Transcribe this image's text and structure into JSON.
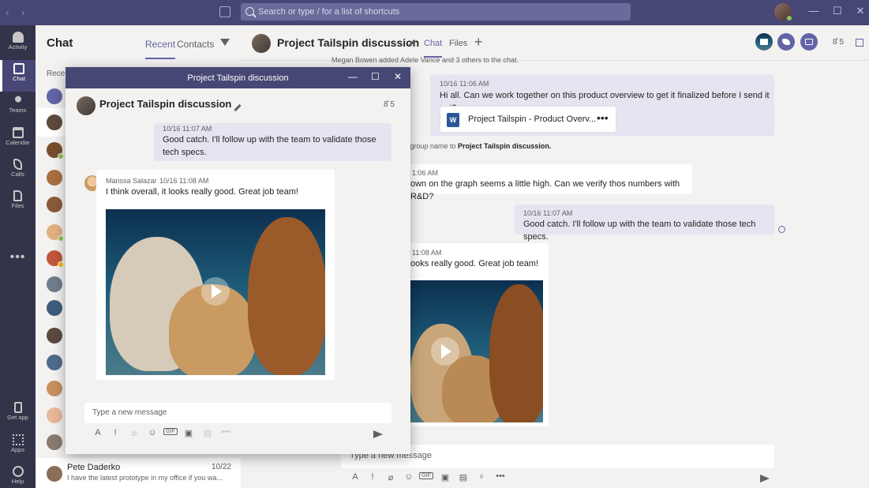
{
  "titlebar": {
    "search_placeholder": "Search or type / for a list of shortcuts",
    "back": "‹",
    "forward": "›",
    "minimize": "—",
    "maximize": "☐",
    "close": "✕"
  },
  "rail": [
    {
      "label": "Activity"
    },
    {
      "label": "Chat"
    },
    {
      "label": "Teams"
    },
    {
      "label": "Calendar"
    },
    {
      "label": "Calls"
    },
    {
      "label": "Files"
    },
    {
      "label": "Get app"
    },
    {
      "label": "Apps"
    },
    {
      "label": "Help"
    }
  ],
  "rail_more": "•••",
  "chatlist": {
    "title": "Chat",
    "tab_recent": "Recent",
    "tab_contacts": "Contacts",
    "section_label": "Recen",
    "colors": [
      "#6264a7",
      "#5c4a3d",
      "#7a4e2d",
      "#a86f3f",
      "#8b5a3c",
      "#e0b080",
      "#c0563a",
      "#6d7d8b",
      "#3e5d7a",
      "#5a4a40",
      "#4e6b8a",
      "#c89060",
      "#e8b898",
      "#8a7a70",
      "#4d5b69"
    ],
    "statuses": [
      "none",
      "none",
      "green",
      "none",
      "none",
      "green",
      "yellow",
      "none",
      "none",
      "none",
      "none",
      "none",
      "none",
      "none",
      "none"
    ],
    "pete": {
      "name": "Pete Daderko",
      "date": "10/22",
      "preview": "I have the latest prototype in my office if you wa..."
    }
  },
  "main": {
    "title": "Project Tailspin discussion",
    "tab_chat": "Chat",
    "tab_files": "Files",
    "tab_add": "+",
    "people_count": "8̊ 5",
    "sys1": "Megan Bowen added Adele Vance and 3 others to the chat.",
    "msg1": {
      "time": "10/16 11:06 AM",
      "text": "Hi all.  Can we work together on this product overview to get it finalized before I send it out?"
    },
    "file": {
      "name": "Project Tailspin - Product Overv...",
      "more": "•••",
      "icon_text": "W"
    },
    "sys2_prefix": "e group name to ",
    "sys2_name": "Project Tailspin discussion.",
    "msg2": {
      "time": "1:06 AM",
      "text": "own on the graph seems a little high.  Can we verify thos numbers with R&D?"
    },
    "msg3": {
      "time": "10/16 11:07 AM",
      "text": "Good catch.  I'll follow up with the team to validate those tech specs."
    },
    "msg4": {
      "time": "11:08 AM",
      "text": "ooks really good.  Great job team!"
    },
    "compose_placeholder": "Type a new message"
  },
  "popup": {
    "window_title": "Project Tailspin discussion",
    "minimize": "—",
    "maximize": "☐",
    "close": "✕",
    "header_title": "Project Tailspin discussion",
    "people_count": "8̊ 5",
    "msg1": {
      "time": "10/16 11:07 AM",
      "text": "Good catch.  I'll follow up with the team to validate those tech specs."
    },
    "msg2": {
      "author": "Marissa Salazar",
      "time": "10/16 11:08 AM",
      "text": "I think overall, it looks really good.  Great job team!"
    },
    "compose_placeholder": "Type a new message"
  },
  "toolbar": {
    "format": "A",
    "important": "!",
    "attach": "⌀",
    "emoji": "☺",
    "gif": "GIF",
    "sticker": "▣",
    "meet": "▤",
    "praise": "♀",
    "more": "•••"
  },
  "colors": {
    "accent": "#6264a7",
    "titlebar": "#464775",
    "rail": "#33344a",
    "me_bubble": "#e5e5f1"
  }
}
